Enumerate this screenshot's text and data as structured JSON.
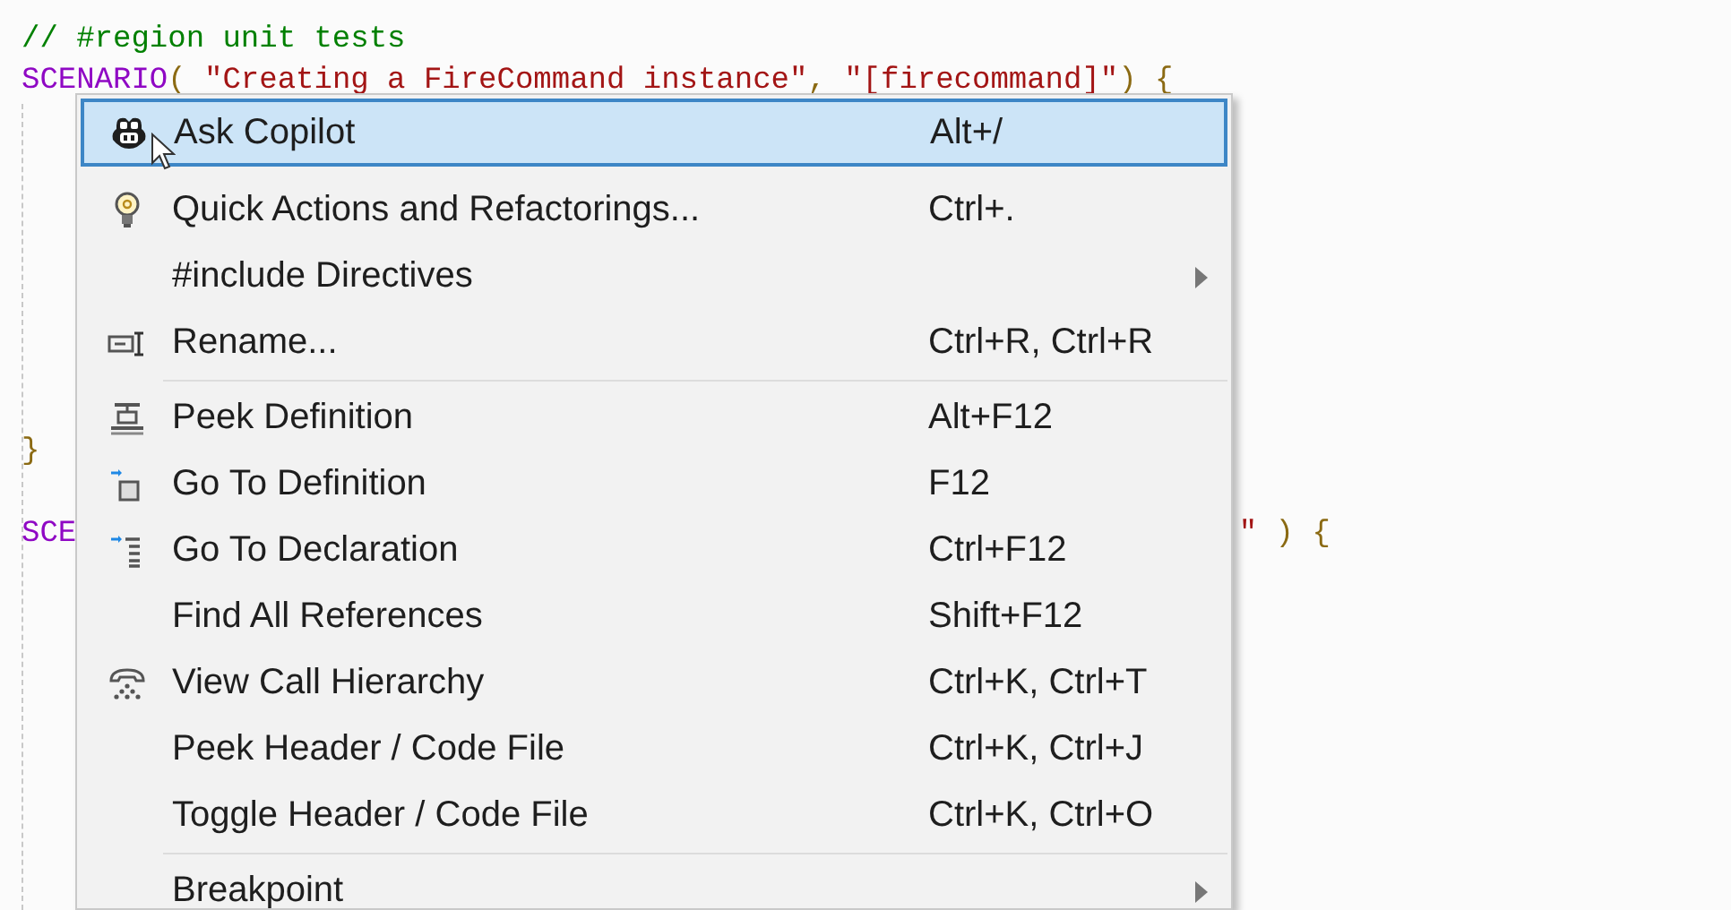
{
  "editor": {
    "lines": [
      {
        "segments": [
          {
            "text": "// #region unit tests",
            "kind": "comment"
          }
        ]
      },
      {
        "segments": [
          {
            "text": "SCENARIO",
            "kind": "macro"
          },
          {
            "text": "( ",
            "kind": "punct"
          },
          {
            "text": "\"Creating a FireCommand instance\"",
            "kind": "string"
          },
          {
            "text": ", ",
            "kind": "punct"
          },
          {
            "text": "\"[firecommand]\"",
            "kind": "string"
          },
          {
            "text": ") {",
            "kind": "punct"
          }
        ]
      },
      {
        "segments": [
          {
            "text": "}",
            "kind": "punct"
          }
        ]
      },
      {
        "segments": [
          {
            "text": "SCE",
            "kind": "macro"
          }
        ],
        "tail": [
          {
            "text": "\"",
            "kind": "string"
          },
          {
            "text": " ) {",
            "kind": "punct"
          }
        ]
      }
    ]
  },
  "context_menu": {
    "items": [
      {
        "kind": "command",
        "label": "Ask Copilot",
        "shortcut": "Alt+/",
        "selected": true,
        "submenu": false
      },
      {
        "kind": "command",
        "label": "Quick Actions and Refactorings...",
        "shortcut": "Ctrl+.",
        "selected": false,
        "submenu": false
      },
      {
        "kind": "command",
        "label": "#include Directives",
        "selected": false,
        "submenu": true
      },
      {
        "kind": "command",
        "label": "Rename...",
        "shortcut": "Ctrl+R, Ctrl+R",
        "selected": false,
        "submenu": false
      },
      {
        "kind": "separator"
      },
      {
        "kind": "command",
        "label": "Peek Definition",
        "shortcut": "Alt+F12",
        "selected": false,
        "submenu": false
      },
      {
        "kind": "command",
        "label": "Go To Definition",
        "shortcut": "F12",
        "selected": false,
        "submenu": false
      },
      {
        "kind": "command",
        "label": "Go To Declaration",
        "shortcut": "Ctrl+F12",
        "selected": false,
        "submenu": false
      },
      {
        "kind": "command",
        "label": "Find All References",
        "shortcut": "Shift+F12",
        "selected": false,
        "submenu": false
      },
      {
        "kind": "command",
        "label": "View Call Hierarchy",
        "shortcut": "Ctrl+K, Ctrl+T",
        "selected": false,
        "submenu": false
      },
      {
        "kind": "command",
        "label": "Peek Header / Code File",
        "shortcut": "Ctrl+K, Ctrl+J",
        "selected": false,
        "submenu": false
      },
      {
        "kind": "command",
        "label": "Toggle Header / Code File",
        "shortcut": "Ctrl+K, Ctrl+O",
        "selected": false,
        "submenu": false
      },
      {
        "kind": "separator"
      },
      {
        "kind": "command",
        "label": "Breakpoint",
        "selected": false,
        "submenu": true
      }
    ]
  }
}
